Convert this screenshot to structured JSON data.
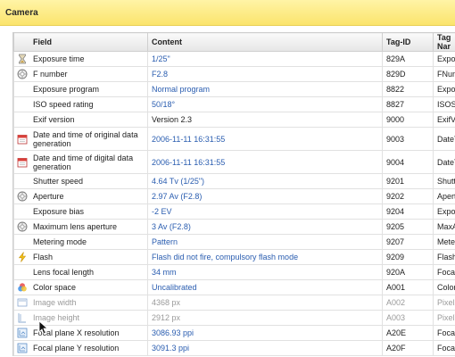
{
  "section": {
    "title": "Camera"
  },
  "columns": {
    "field": "Field",
    "content": "Content",
    "tag_id": "Tag-ID",
    "tag_name": "Tag Nar"
  },
  "rows": [
    {
      "field": "Exposure time",
      "content": "1/25\"",
      "tag_id": "829A",
      "tag_name": "Exposure",
      "icon": "hourglass-icon"
    },
    {
      "field": "F number",
      "content": "F2.8",
      "tag_id": "829D",
      "tag_name": "FNumber",
      "icon": "aperture-icon"
    },
    {
      "field": "Exposure program",
      "content": "Normal program",
      "tag_id": "8822",
      "tag_name": "Exposure",
      "icon": ""
    },
    {
      "field": "ISO speed rating",
      "content": "50/18°",
      "tag_id": "8827",
      "tag_name": "ISOSpee",
      "icon": ""
    },
    {
      "field": "Exif version",
      "content": "Version 2.3",
      "tag_id": "9000",
      "tag_name": "ExifVersi",
      "icon": ""
    },
    {
      "field": "Date and time of original data generation",
      "content": "2006-11-11 16:31:55",
      "tag_id": "9003",
      "tag_name": "DateTime",
      "icon": "calendar-icon"
    },
    {
      "field": "Date and time of digital data generation",
      "content": "2006-11-11 16:31:55",
      "tag_id": "9004",
      "tag_name": "DateTime",
      "icon": "calendar-icon"
    },
    {
      "field": "Shutter speed",
      "content": "4.64 Tv (1/25\")",
      "tag_id": "9201",
      "tag_name": "ShutterS|",
      "icon": ""
    },
    {
      "field": "Aperture",
      "content": "2.97 Av (F2.8)",
      "tag_id": "9202",
      "tag_name": "Aperture",
      "icon": "aperture-icon"
    },
    {
      "field": "Exposure bias",
      "content": "-2 EV",
      "tag_id": "9204",
      "tag_name": "Exposure",
      "icon": ""
    },
    {
      "field": "Maximum lens aperture",
      "content": "3 Av (F2.8)",
      "tag_id": "9205",
      "tag_name": "MaxAper",
      "icon": "aperture-icon"
    },
    {
      "field": "Metering mode",
      "content": "Pattern",
      "tag_id": "9207",
      "tag_name": "Metering|",
      "icon": ""
    },
    {
      "field": "Flash",
      "content": "Flash did not fire, compulsory flash mode",
      "tag_id": "9209",
      "tag_name": "Flash",
      "icon": "flash-icon"
    },
    {
      "field": "Lens focal length",
      "content": "34 mm",
      "tag_id": "920A",
      "tag_name": "FocalLen",
      "icon": ""
    },
    {
      "field": "Color space",
      "content": "Uncalibrated",
      "tag_id": "A001",
      "tag_name": "ColorSpa",
      "icon": "color-space-icon"
    },
    {
      "field": "Image width",
      "content": "4368 px",
      "tag_id": "A002",
      "tag_name": "PixelXDim",
      "icon": "image-width-icon"
    },
    {
      "field": "Image height",
      "content": "2912 px",
      "tag_id": "A003",
      "tag_name": "PixelYDim",
      "icon": "image-height-icon"
    },
    {
      "field": "Focal plane X resolution",
      "content": "3086.93 ppi",
      "tag_id": "A20E",
      "tag_name": "FocalPlar",
      "icon": "resolution-icon"
    },
    {
      "field": "Focal plane Y resolution",
      "content": "3091.3 ppi",
      "tag_id": "A20F",
      "tag_name": "FocalPlar",
      "icon": "resolution-icon"
    }
  ],
  "colors": {
    "header_gradient_top": "#fff4a6",
    "header_gradient_bottom": "#fbe46c",
    "link_blue": "#2a5db0",
    "dim_gray": "#9a9a9a"
  }
}
